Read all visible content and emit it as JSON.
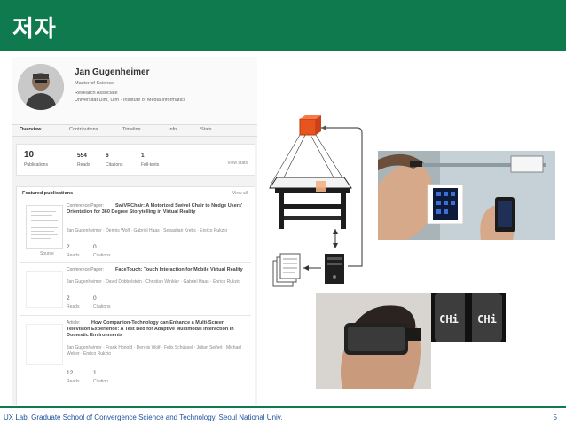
{
  "slide": {
    "title": "저자",
    "footer": "UX Lab, Graduate School of Convergence Science and Technology, Seoul National Univ.",
    "page_number": "5",
    "accent_color": "#0f7a4e"
  },
  "profile": {
    "name": "Jan Gugenheimer",
    "degree": "Master of Science",
    "position": "Research Associate",
    "affiliation": "Universität Ulm, Ulm · Institute of Media Informatics",
    "tabs": [
      "Overview",
      "Contributions",
      "Timeline",
      "Info",
      "Stats"
    ],
    "stats": [
      {
        "value": "10",
        "label": "Publications"
      },
      {
        "value": "554",
        "label": "Reads"
      },
      {
        "value": "6",
        "label": "Citations"
      },
      {
        "value": "1",
        "label": "Full-texts"
      }
    ],
    "view_stats": "View stats",
    "featured_title": "Featured publications",
    "view_all": "View all",
    "source_label": "Source",
    "publications": [
      {
        "type": "Conference Paper:",
        "title": "SwiVRChair: A Motorized Swivel Chair to Nudge Users' Orientation for 360 Degree Storytelling in Virtual Reality",
        "authors": "Jan Gugenheimer · Dennis Wolf · Gabriel Haas · Sebastian Krebs · Enrico Rukzio",
        "reads": "2",
        "reads_label": "Reads",
        "citations": "0",
        "citations_label": "Citations"
      },
      {
        "type": "Conference Paper:",
        "title": "FaceTouch: Touch Interaction for Mobile Virtual Reality",
        "authors": "Jan Gugenheimer · David Dobbelstein · Christian Winkler · Gabriel Haas · Enrico Rukzio",
        "reads": "2",
        "reads_label": "Reads",
        "citations": "0",
        "citations_label": "Citations"
      },
      {
        "type": "Article:",
        "title": "How Companion-Technology can Enhance a Multi-Screen Television Experience: A Test Bed for Adaptive Multimodal Interaction in Domestic Environments",
        "authors": "Jan Gugenheimer · Frank Honold · Dennis Wolf · Felix Schüssel · Julian Seifert · Michael Weber · Enrico Rukzio",
        "reads": "12",
        "reads_label": "Reads",
        "citations": "1",
        "citations_label": "Citation"
      }
    ]
  },
  "images": {
    "hmd_labels": [
      "CHi",
      "CHi"
    ]
  }
}
